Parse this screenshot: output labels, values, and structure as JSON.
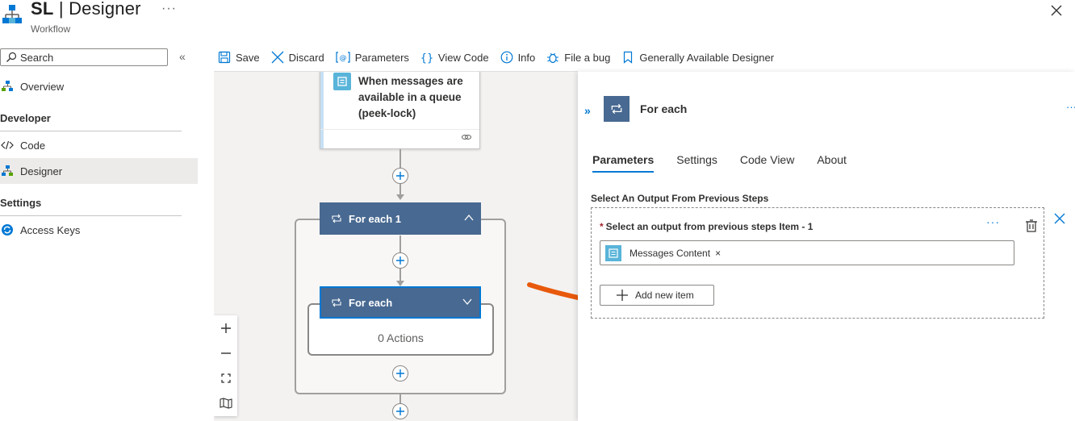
{
  "header": {
    "title_main": "SL",
    "title_sep": " | ",
    "title_page": "Designer",
    "subtitle": "Workflow",
    "more": "···"
  },
  "sidebar": {
    "search_placeholder": "Search",
    "collapse": "«",
    "items": [
      {
        "label": "Overview",
        "icon": "overview-icon"
      },
      {
        "label": "Code",
        "icon": "code-icon"
      },
      {
        "label": "Designer",
        "icon": "designer-icon",
        "active": true
      },
      {
        "label": "Access Keys",
        "icon": "keys-icon"
      }
    ],
    "sections": [
      "Developer",
      "Settings"
    ]
  },
  "toolbar": {
    "save": "Save",
    "discard": "Discard",
    "parameters": "Parameters",
    "view_code": "View Code",
    "info": "Info",
    "file_bug": "File a bug",
    "ga_designer": "Generally Available Designer"
  },
  "canvas": {
    "trigger_title": "When messages are available in a queue (peek-lock)",
    "foreach_outer": "For each 1",
    "foreach_inner": "For each",
    "zero_actions": "0 Actions"
  },
  "panel": {
    "expand": "»",
    "title": "For each",
    "more": "···",
    "tabs": [
      "Parameters",
      "Settings",
      "Code View",
      "About"
    ],
    "active_tab": "Parameters",
    "section_label": "Select An Output From Previous Steps",
    "required_mark": "*",
    "item_label": "Select an output from previous steps Item - 1",
    "item_more": "···",
    "token_label": "Messages Content",
    "token_remove": "×",
    "add_item": "Add new item"
  },
  "colors": {
    "accent": "#0078d4",
    "scope_header": "#486991",
    "canvas_bg": "#f3f2f1",
    "annotation": "#e8590c"
  }
}
